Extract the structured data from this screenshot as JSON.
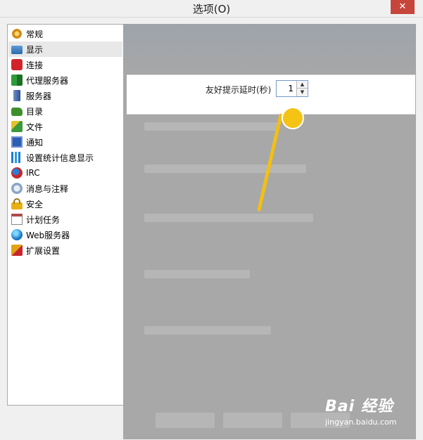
{
  "window": {
    "title": "选项(O)",
    "close_label": "✕"
  },
  "sidebar": {
    "items": [
      {
        "label": "常规",
        "icon": "gear-icon"
      },
      {
        "label": "显示",
        "icon": "monitor-icon",
        "selected": true
      },
      {
        "label": "连接",
        "icon": "plug-icon"
      },
      {
        "label": "代理服务器",
        "icon": "proxy-icon"
      },
      {
        "label": "服务器",
        "icon": "server-icon"
      },
      {
        "label": "目录",
        "icon": "folder-icon"
      },
      {
        "label": "文件",
        "icon": "file-icon"
      },
      {
        "label": "通知",
        "icon": "notification-icon"
      },
      {
        "label": "设置统计信息显示",
        "icon": "statistics-icon"
      },
      {
        "label": "IRC",
        "icon": "irc-icon"
      },
      {
        "label": "消息与注释",
        "icon": "message-icon"
      },
      {
        "label": "安全",
        "icon": "lock-icon"
      },
      {
        "label": "计划任务",
        "icon": "calendar-icon"
      },
      {
        "label": "Web服务器",
        "icon": "web-globe-icon"
      },
      {
        "label": "扩展设置",
        "icon": "extension-icon"
      }
    ]
  },
  "display_settings": {
    "tooltip_delay_label": "友好提示延时(秒)",
    "tooltip_delay_value": "1"
  },
  "watermark": {
    "logo": "Bai 经验",
    "url": "jingyan.baidu.com"
  },
  "colors": {
    "annotation": "#f5c313",
    "overlay": "#a8a8a8"
  }
}
